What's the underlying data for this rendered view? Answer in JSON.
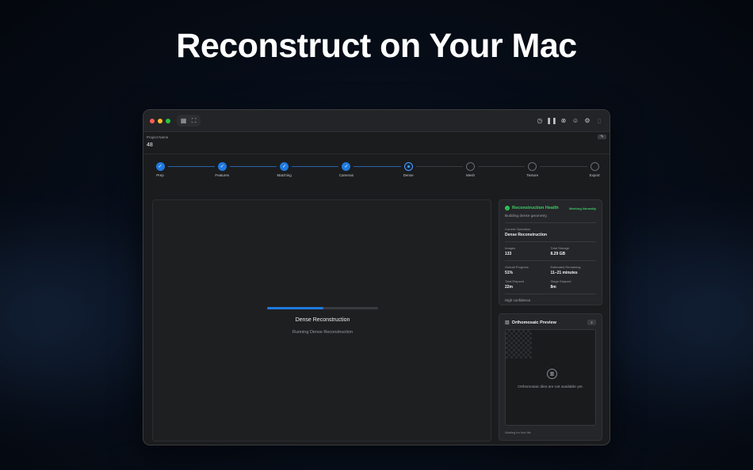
{
  "headline": "Reconstruct on Your Mac",
  "toolbar": {
    "left_icons": [
      "grid-icon",
      "scan-icon"
    ],
    "right_icons": [
      "history-icon",
      "pause-icon",
      "cancel-icon",
      "person-icon",
      "gear-icon",
      "trash-icon"
    ]
  },
  "project": {
    "label": "Project Name",
    "value": "48",
    "edit_icon": "pencil-icon"
  },
  "stages": [
    {
      "label": "Prep",
      "state": "done"
    },
    {
      "label": "Features",
      "state": "done"
    },
    {
      "label": "Matching",
      "state": "done"
    },
    {
      "label": "Cameras",
      "state": "done"
    },
    {
      "label": "Dense",
      "state": "active"
    },
    {
      "label": "Mesh",
      "state": "todo"
    },
    {
      "label": "Texture",
      "state": "todo"
    },
    {
      "label": "Export",
      "state": "todo"
    }
  ],
  "main": {
    "progress_fraction": 0.51,
    "title": "Dense Reconstruction",
    "subtitle": "Running Dense Reconstruction"
  },
  "health": {
    "title": "Reconstruction Health",
    "status": "Working Normally",
    "description": "Building dense geometry.",
    "current_operation_label": "Current Operation",
    "current_operation_value": "Dense Reconstruction",
    "images_label": "Images",
    "images_value": "133",
    "storage_label": "Total Storage",
    "storage_value": "8.29 GB",
    "progress_label": "Overall Progress",
    "progress_value": "51%",
    "remaining_label": "Estimated Remaining",
    "remaining_value": "11–21 minutes",
    "elapsed_label": "Total Elapsed",
    "elapsed_value": "22m",
    "stage_elapsed_label": "Stage Elapsed",
    "stage_elapsed_value": "8m",
    "confidence": "High confidence"
  },
  "ortho": {
    "title": "Orthomosaic Preview",
    "placeholder": "Orthomosaic tiles are not available yet.",
    "footer": "Waiting for first tile"
  },
  "colors": {
    "accent": "#1f7ae0",
    "healthy": "#3ccd65"
  }
}
